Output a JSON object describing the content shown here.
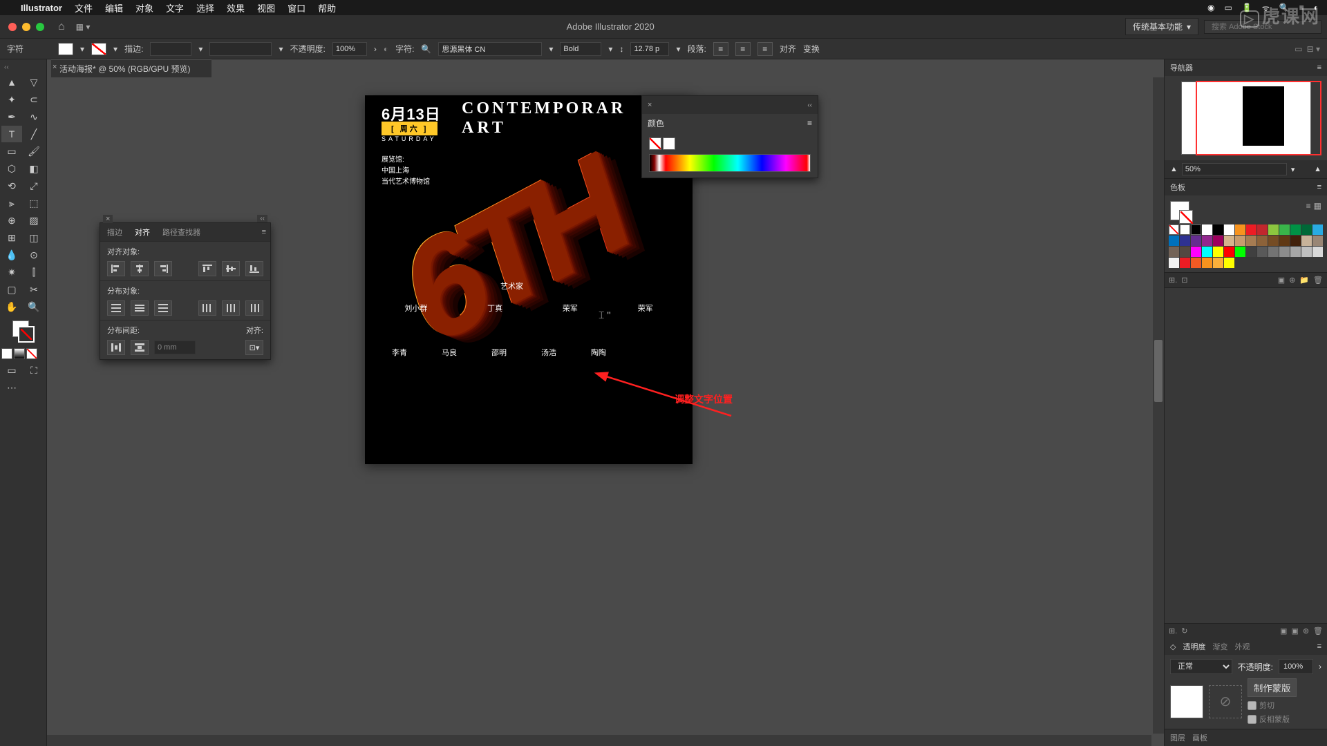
{
  "menubar": {
    "app": "Illustrator",
    "items": [
      "文件",
      "编辑",
      "对象",
      "文字",
      "选择",
      "效果",
      "视图",
      "窗口",
      "帮助"
    ]
  },
  "appbar": {
    "title": "Adobe Illustrator 2020",
    "workspace": "传统基本功能",
    "search_placeholder": "搜索 Adobe Stock"
  },
  "controlbar": {
    "char_label": "字符",
    "stroke_label": "描边:",
    "opacity_label": "不透明度:",
    "opacity_value": "100%",
    "font_label": "字符:",
    "font_name": "思源黑体 CN",
    "font_weight": "Bold",
    "font_size": "12.78 p",
    "para_label": "段落:",
    "align_label": "对齐",
    "transform_label": "变换"
  },
  "document": {
    "tab": "活动海报* @ 50% (RGB/GPU 预览)"
  },
  "annotation": "调整文字位置",
  "poster": {
    "date": "6月13日",
    "day": "[ 周六 ]",
    "saturday": "SATURDAY",
    "title1": "CONTEMPORAR",
    "title2": "ART",
    "venue1": "展览馆:",
    "venue2": "中国上海",
    "venue3": "当代艺术博物馆",
    "artist_heading": "艺术家",
    "names_row1": [
      "刘小群",
      "丁真",
      "荣军",
      "荣军"
    ],
    "names_row2": [
      "李青",
      "马良",
      "邵明",
      "汤浩",
      "陶陶"
    ]
  },
  "align_panel": {
    "tab_stroke": "描边",
    "tab_align": "对齐",
    "tab_pathfinder": "路径查找器",
    "sec_align": "对齐对象:",
    "sec_dist": "分布对象:",
    "sec_spacing": "分布间距:",
    "align_to": "对齐:",
    "spacing_value": "0 mm"
  },
  "color_panel": {
    "title": "颜色"
  },
  "navigator": {
    "title": "导航器",
    "zoom": "50%"
  },
  "swatches": {
    "title": "色板"
  },
  "transparency": {
    "tab_trans": "透明度",
    "tab_grad": "渐变",
    "tab_appear": "外观",
    "mode": "正常",
    "opacity_label": "不透明度:",
    "opacity": "100%",
    "make_mask": "制作蒙版",
    "clip": "剪切",
    "invert": "反相蒙版"
  },
  "layers": {
    "tab_layers": "图层",
    "tab_artboards": "画板"
  },
  "swatch_colors": [
    "#ffffff",
    "#000000",
    "#ffffff",
    "#f7931e",
    "#ed1c24",
    "#c1272d",
    "#8cc63f",
    "#39b54a",
    "#009245",
    "#006837",
    "#29abe2",
    "#0071bc",
    "#2e3192",
    "#662d91",
    "#93278f",
    "#9e005d",
    "#d4b48c",
    "#c69c6d",
    "#a67c52",
    "#8c6239",
    "#754c24",
    "#603813",
    "#42210b",
    "#c7b299",
    "#998675",
    "#736357",
    "#534741",
    "#ff00ff",
    "#00ffff",
    "#ffff00",
    "#ff0000",
    "#00ff00",
    "#404040",
    "#595959",
    "#737373",
    "#8c8c8c",
    "#a6a6a6",
    "#bfbfbf",
    "#d9d9d9",
    "#f2f2f2",
    "#ed1c24",
    "#f15a24",
    "#f7931e",
    "#fbb03b",
    "#ffff00"
  ]
}
